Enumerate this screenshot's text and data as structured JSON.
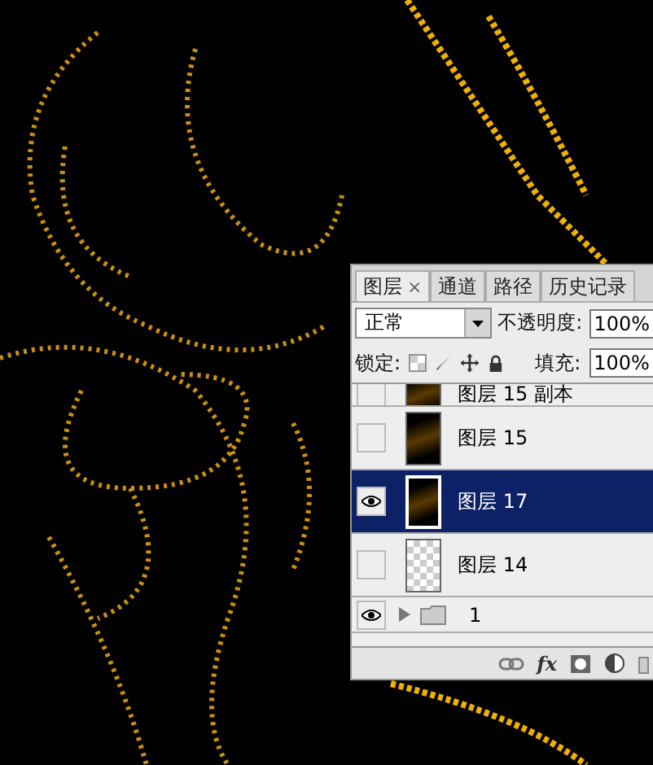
{
  "tabs": [
    {
      "label": "图层",
      "selected": true,
      "close": "×"
    },
    {
      "label": "通道",
      "selected": false
    },
    {
      "label": "路径",
      "selected": false
    },
    {
      "label": "历史记录",
      "selected": false
    }
  ],
  "blend_mode": {
    "value": "正常"
  },
  "opacity": {
    "label": "不透明度:",
    "value": "100%"
  },
  "lock": {
    "label": "锁定:"
  },
  "fill": {
    "label": "填充:",
    "value": "100%"
  },
  "layers": [
    {
      "kind": "layer",
      "name": "图层 15 副本",
      "visible": false,
      "selected": false,
      "transparent": false
    },
    {
      "kind": "layer",
      "name": "图层 15",
      "visible": false,
      "selected": false,
      "transparent": false
    },
    {
      "kind": "layer",
      "name": "图层 17",
      "visible": true,
      "selected": true,
      "transparent": false
    },
    {
      "kind": "layer",
      "name": "图层 14",
      "visible": false,
      "selected": false,
      "transparent": true
    },
    {
      "kind": "group",
      "name": "1",
      "visible": true,
      "selected": false,
      "expanded": false
    }
  ],
  "bottom_fx": "fx"
}
